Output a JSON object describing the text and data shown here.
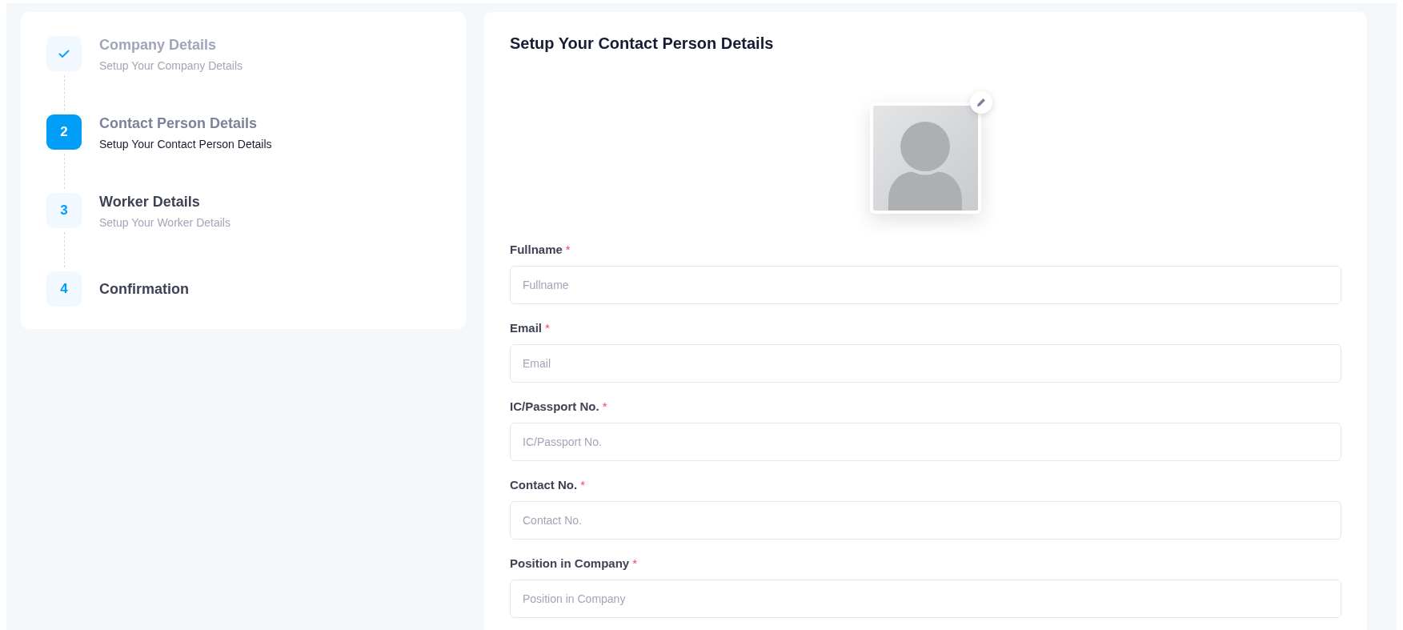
{
  "steps": [
    {
      "kind": "completed",
      "title": "Company Details",
      "subtitle": "Setup Your Company Details"
    },
    {
      "number": "2",
      "kind": "current",
      "title": "Contact Person Details",
      "subtitle": "Setup Your Contact Person Details"
    },
    {
      "number": "3",
      "kind": "pending",
      "title": "Worker Details",
      "subtitle": "Setup Your Worker Details"
    },
    {
      "number": "4",
      "kind": "pending",
      "title": "Confirmation"
    }
  ],
  "form": {
    "title": "Setup Your Contact Person Details",
    "avatar": {
      "kind": "placeholder"
    },
    "fields": [
      {
        "label": "Fullname",
        "required_mark": "*",
        "placeholder": "Fullname"
      },
      {
        "label": "Email",
        "required_mark": "*",
        "placeholder": "Email"
      },
      {
        "label": "IC/Passport No.",
        "required_mark": "*",
        "placeholder": "IC/Passport No."
      },
      {
        "label": "Contact No.",
        "required_mark": "*",
        "placeholder": "Contact No."
      },
      {
        "label": "Position in Company",
        "required_mark": "*",
        "placeholder": "Position in Company"
      }
    ]
  }
}
